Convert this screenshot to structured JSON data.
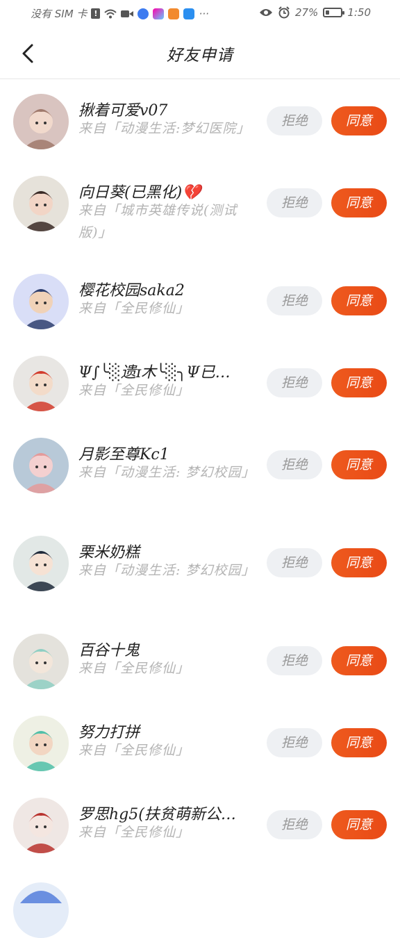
{
  "status_bar": {
    "carrier": "没有 SIM 卡",
    "more": "···",
    "battery_text": "27%",
    "battery_level": 0.27,
    "time": "1:50"
  },
  "nav": {
    "title": "好友申请"
  },
  "buttons": {
    "reject": "拒绝",
    "accept": "同意"
  },
  "requests": [
    {
      "name": "揪着可爱v07",
      "source": "来自「动漫生活:梦幻医院」"
    },
    {
      "name": "向日葵(已黑化)💔",
      "source": "来自「城市英雄传说(测试版)」"
    },
    {
      "name": "樱花校园saka2",
      "source": "来自「全民修仙」"
    },
    {
      "name": "Ψ∫╰░遗ɪ木╰░╮Ψ已…",
      "source": "来自「全民修仙」"
    },
    {
      "name": "月影至尊Kc1",
      "source": "来自「动漫生活: 梦幻校园」"
    },
    {
      "name": "栗米奶糕",
      "source": "来自「动漫生活: 梦幻校园」"
    },
    {
      "name": "百谷十鬼",
      "source": "来自「全民修仙」"
    },
    {
      "name": "努力打拼",
      "source": "来自「全民修仙」"
    },
    {
      "name": "罗思hg5(扶贫萌新公…",
      "source": "来自「全民修仙」"
    }
  ]
}
